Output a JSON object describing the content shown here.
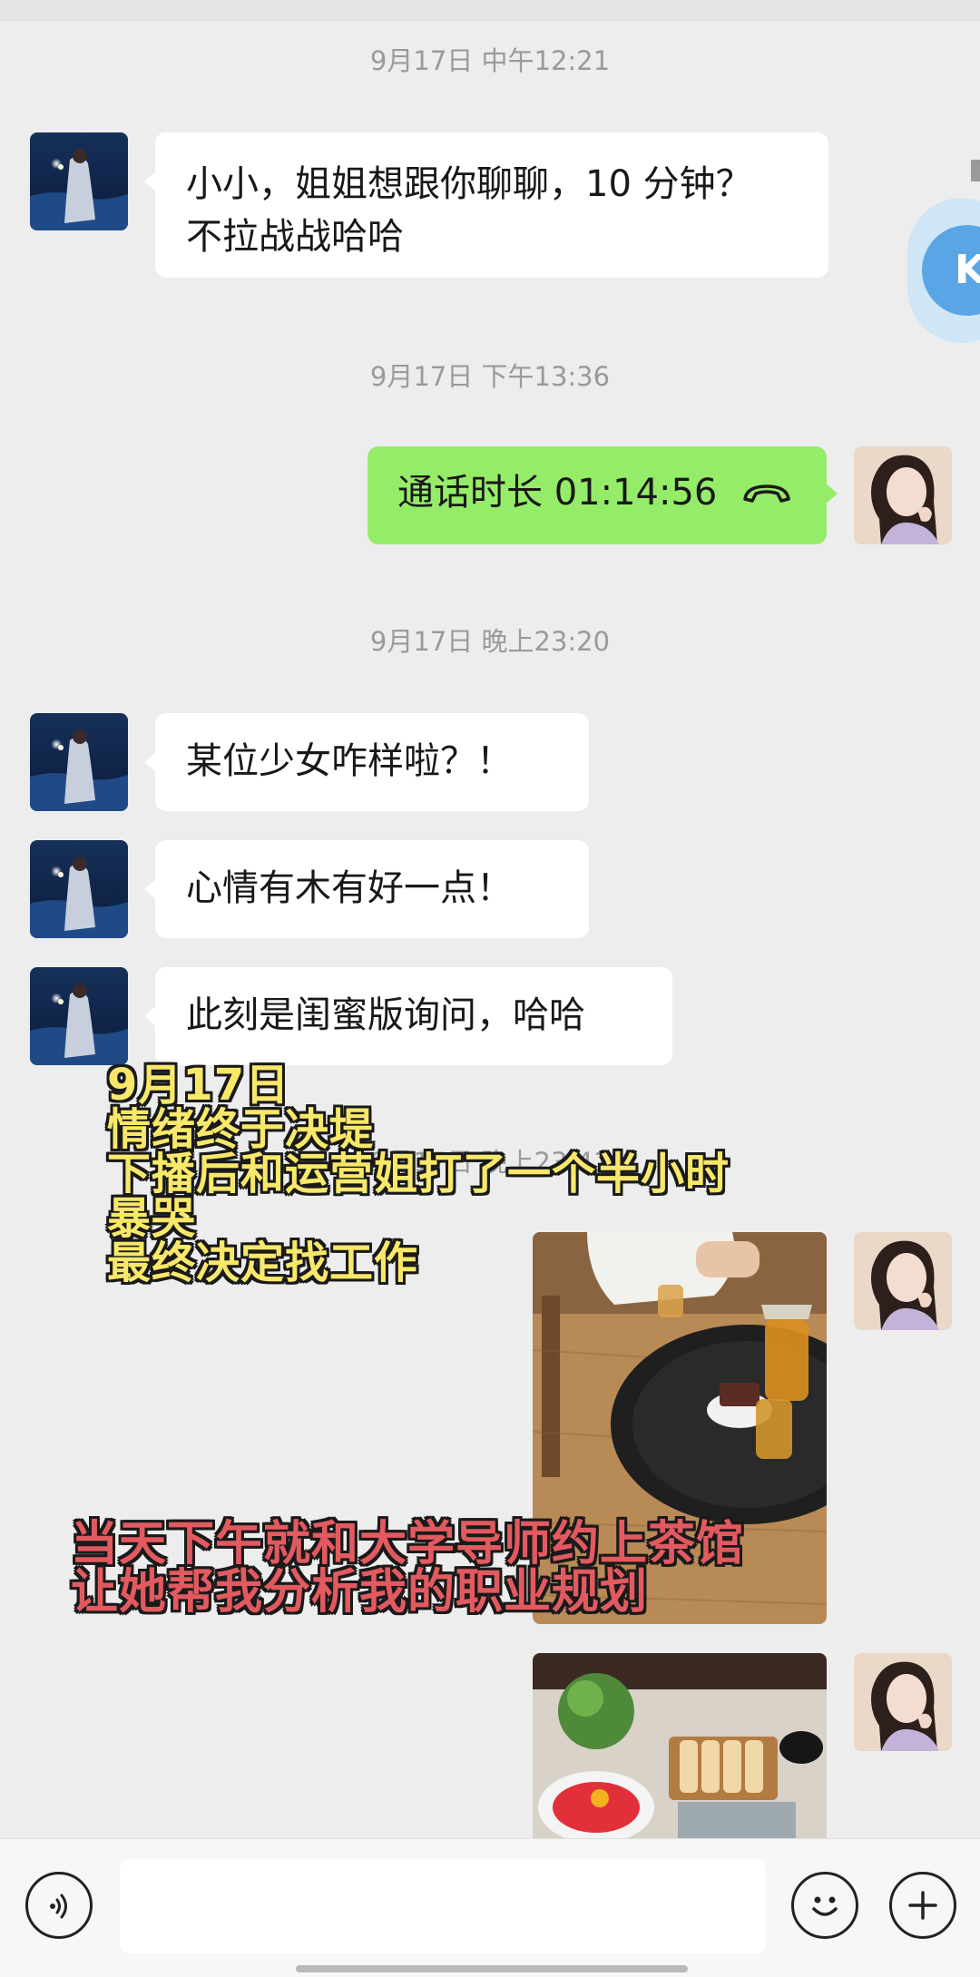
{
  "timestamps": {
    "t1": "9月17日 中午12:21",
    "t2": "9月17日 下午13:36",
    "t3": "9月17日 晚上23:20",
    "t4": "9月17日 晚上23:41"
  },
  "messages": {
    "m1_line1": "小小，姐姐想跟你聊聊，10 分钟？",
    "m1_line2": "不拉战战哈哈",
    "call_text": "通话时长 01:14:56",
    "m2": "某位少女咋样啦？！",
    "m3": "心情有木有好一点！",
    "m4": "此刻是闺蜜版询问，哈哈"
  },
  "overlay_yellow": {
    "line1": "9月17日",
    "line2": "情绪终于决堤",
    "line3": "下播后和运营姐打了一个半小时",
    "line4": "暴哭",
    "line5": "最终决定找工作"
  },
  "overlay_red": {
    "line1": "当天下午就和大学导师约上茶馆",
    "line2": "让她帮我分析我的职业规划"
  },
  "floating_button": {
    "letter": "K"
  },
  "colors": {
    "background": "#ededed",
    "outgoing_bubble": "#95ec69",
    "incoming_bubble": "#ffffff",
    "overlay_yellow": "#f7e86a",
    "overlay_red": "#e25a60"
  },
  "icons": [
    "voice-icon",
    "phone-hangup-icon",
    "emoji-icon",
    "plus-icon"
  ]
}
